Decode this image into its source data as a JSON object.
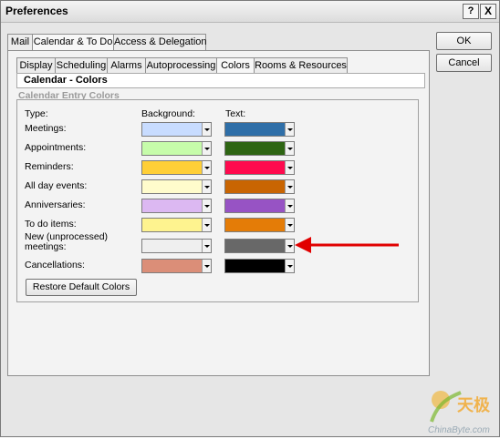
{
  "window": {
    "title": "Preferences"
  },
  "title_buttons": {
    "help": "?",
    "close": "X"
  },
  "dialog_buttons": {
    "ok": "OK",
    "cancel": "Cancel"
  },
  "top_tabs": [
    "Mail",
    "Calendar & To Do",
    "Access & Delegation"
  ],
  "sub_tabs": [
    "Display",
    "Scheduling",
    "Alarms",
    "Autoprocessing",
    "Colors",
    "Rooms & Resources"
  ],
  "section": {
    "header": "Calendar - Colors",
    "group": "Calendar Entry Colors"
  },
  "columns": {
    "type": "Type:",
    "background": "Background:",
    "text": "Text:"
  },
  "rows": [
    {
      "label": "Meetings:",
      "bg": "#c8dcff",
      "fg": "#2f6fa8"
    },
    {
      "label": "Appointments:",
      "bg": "#c6fcaa",
      "fg": "#2e6513"
    },
    {
      "label": "Reminders:",
      "bg": "#ffcf37",
      "fg": "#ff0a4e"
    },
    {
      "label": "All day events:",
      "bg": "#fffccc",
      "fg": "#c96502"
    },
    {
      "label": "Anniversaries:",
      "bg": "#dcb8f2",
      "fg": "#9753c4"
    },
    {
      "label": "To do items:",
      "bg": "#fef38f",
      "fg": "#e47c07"
    },
    {
      "label": "New (unprocessed) meetings:",
      "bg": "#efefef",
      "fg": "#686868"
    },
    {
      "label": "Cancellations:",
      "bg": "#db8e78",
      "fg": "#000000"
    }
  ],
  "restore_button": "Restore Default Colors",
  "watermark": {
    "cn": "天极",
    "site": "ChinaByte.com"
  }
}
